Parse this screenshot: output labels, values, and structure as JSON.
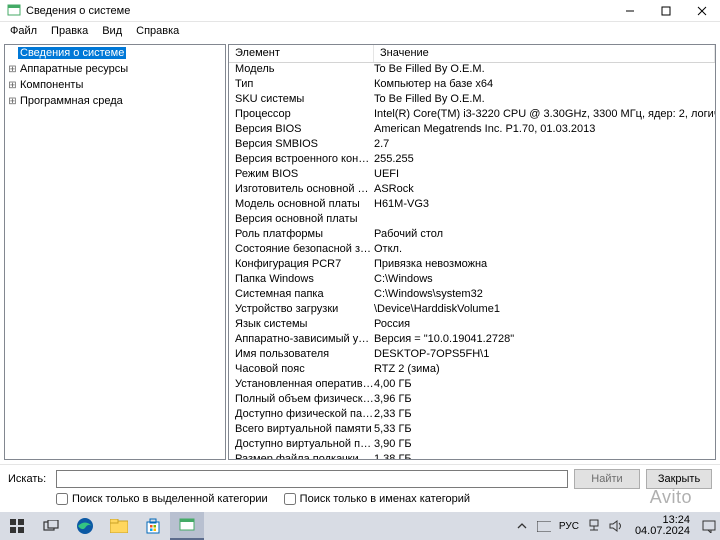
{
  "window": {
    "title": "Сведения о системе"
  },
  "menu": {
    "file": "Файл",
    "edit": "Правка",
    "view": "Вид",
    "help": "Справка"
  },
  "tree": {
    "root": "Сведения о системе",
    "hw": "Аппаратные ресурсы",
    "comp": "Компоненты",
    "sw": "Программная среда"
  },
  "cols": {
    "element": "Элемент",
    "value": "Значение"
  },
  "rows": [
    {
      "k": "Модель",
      "v": "To Be Filled By O.E.M."
    },
    {
      "k": "Тип",
      "v": "Компьютер на базе x64"
    },
    {
      "k": "SKU системы",
      "v": "To Be Filled By O.E.M."
    },
    {
      "k": "Процессор",
      "v": "Intel(R) Core(TM) i3-3220 CPU @ 3.30GHz, 3300 МГц, ядер: 2, логических пр..."
    },
    {
      "k": "Версия BIOS",
      "v": "American Megatrends Inc. P1.70, 01.03.2013"
    },
    {
      "k": "Версия SMBIOS",
      "v": "2.7"
    },
    {
      "k": "Версия встроенного контролл...",
      "v": "255.255"
    },
    {
      "k": "Режим BIOS",
      "v": "UEFI"
    },
    {
      "k": "Изготовитель основной платы",
      "v": "ASRock"
    },
    {
      "k": "Модель основной платы",
      "v": "H61M-VG3"
    },
    {
      "k": "Версия основной платы",
      "v": ""
    },
    {
      "k": "Роль платформы",
      "v": "Рабочий стол"
    },
    {
      "k": "Состояние безопасной загруз...",
      "v": "Откл."
    },
    {
      "k": "Конфигурация PCR7",
      "v": "Привязка невозможна"
    },
    {
      "k": "Папка Windows",
      "v": "C:\\Windows"
    },
    {
      "k": "Системная папка",
      "v": "C:\\Windows\\system32"
    },
    {
      "k": "Устройство загрузки",
      "v": "\\Device\\HarddiskVolume1"
    },
    {
      "k": "Язык системы",
      "v": "Россия"
    },
    {
      "k": "Аппаратно-зависимый уровен...",
      "v": "Версия = \"10.0.19041.2728\""
    },
    {
      "k": "Имя пользователя",
      "v": "DESKTOP-7OPS5FH\\1"
    },
    {
      "k": "Часовой пояс",
      "v": "RTZ 2 (зима)"
    },
    {
      "k": "Установленная оперативная п...",
      "v": "4,00 ГБ"
    },
    {
      "k": "Полный объем физической па...",
      "v": "3,96 ГБ"
    },
    {
      "k": "Доступно физической памяти",
      "v": "2,33 ГБ"
    },
    {
      "k": "Всего виртуальной памяти",
      "v": "5,33 ГБ"
    },
    {
      "k": "Доступно виртуальной памяти",
      "v": "3,90 ГБ"
    },
    {
      "k": "Размер файла подкачки",
      "v": "1,38 ГБ"
    }
  ],
  "search": {
    "label": "Искать:",
    "find": "Найти",
    "close": "Закрыть",
    "cb1": "Поиск только в выделенной категории",
    "cb2": "Поиск только в именах категорий"
  },
  "taskbar": {
    "lang": "РУС",
    "time": "13:24",
    "date": "04.07.2024"
  },
  "watermark": "Avito"
}
